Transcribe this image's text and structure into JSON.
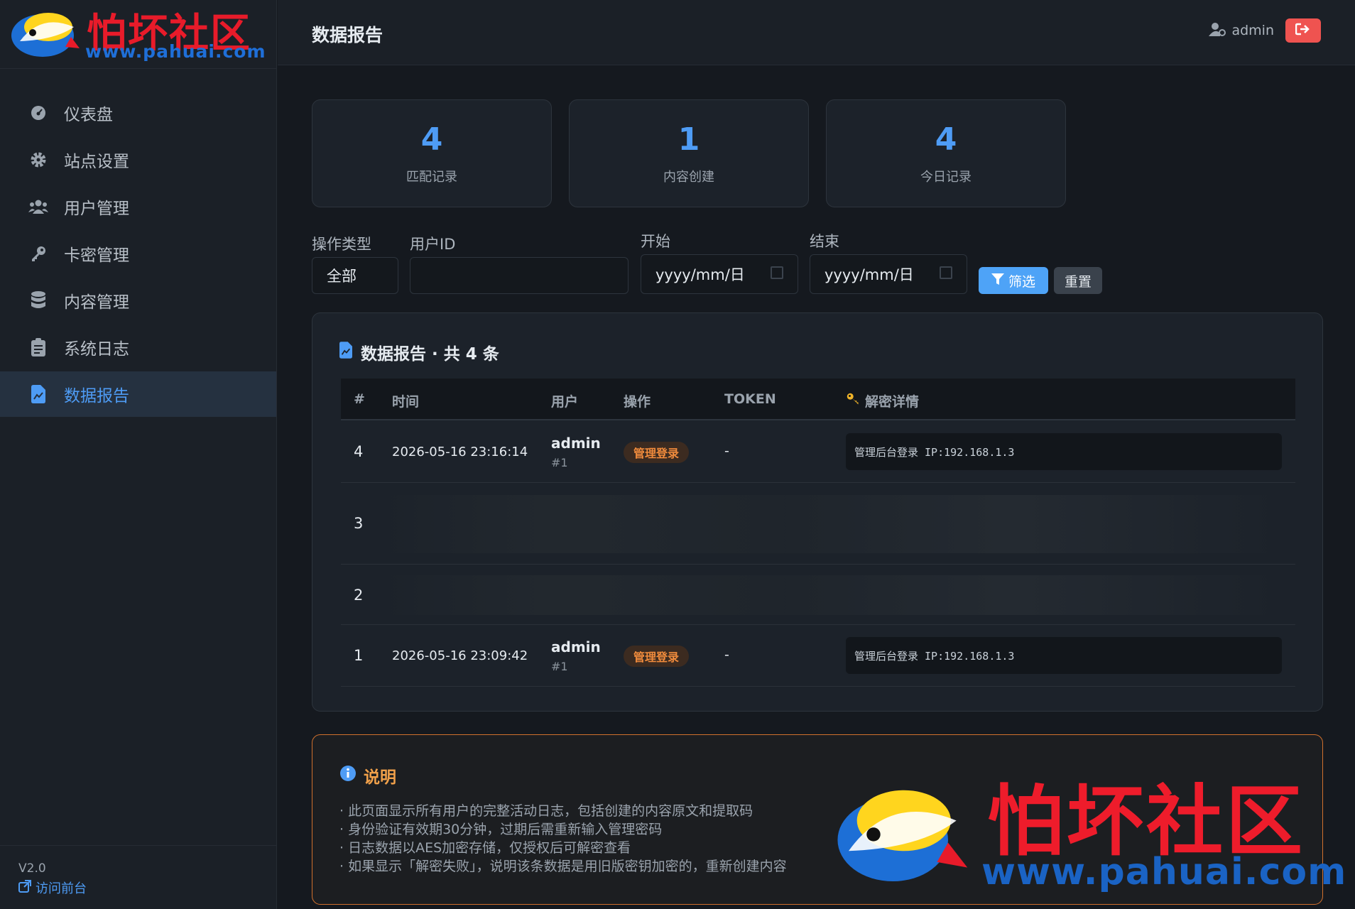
{
  "brand": {
    "logo_cn": "怕坏社区",
    "logo_url": "www.pahuai.com"
  },
  "sidebar": {
    "items": [
      {
        "label": "仪表盘",
        "icon": "dashboard-icon"
      },
      {
        "label": "站点设置",
        "icon": "gear-icon"
      },
      {
        "label": "用户管理",
        "icon": "users-icon"
      },
      {
        "label": "卡密管理",
        "icon": "key-icon"
      },
      {
        "label": "内容管理",
        "icon": "database-icon"
      },
      {
        "label": "系统日志",
        "icon": "clipboard-icon"
      },
      {
        "label": "数据报告",
        "icon": "file-chart-icon",
        "active": true
      }
    ],
    "version": "V2.0",
    "visit_label": "访问前台"
  },
  "header": {
    "title": "数据报告",
    "user": "admin"
  },
  "stats": [
    {
      "value": "4",
      "label": "匹配记录"
    },
    {
      "value": "1",
      "label": "内容创建"
    },
    {
      "value": "4",
      "label": "今日记录"
    }
  ],
  "filters": {
    "type_label": "操作类型",
    "type_value": "全部",
    "userid_label": "用户ID",
    "userid_value": "",
    "start_label": "开始",
    "start_placeholder": "yyyy/mm/日",
    "end_label": "结束",
    "end_placeholder": "yyyy/mm/日",
    "filter_button": "筛选",
    "reset_button": "重置"
  },
  "table": {
    "title": "数据报告 · 共 4 条",
    "columns": [
      "#",
      "时间",
      "用户",
      "操作",
      "TOKEN",
      "解密详情"
    ],
    "rows": [
      {
        "num": "4",
        "time": "2026-05-16 23:16:14",
        "user": "admin",
        "uid": "#1",
        "action": "管理登录",
        "token": "-",
        "detail": "管理后台登录 IP:192.168.1.3"
      },
      {
        "num": "3"
      },
      {
        "num": "2"
      },
      {
        "num": "1",
        "time": "2026-05-16 23:09:42",
        "user": "admin",
        "uid": "#1",
        "action": "管理登录",
        "token": "-",
        "detail": "管理后台登录 IP:192.168.1.3"
      }
    ]
  },
  "note": {
    "title": "说明",
    "lines": [
      "· 此页面显示所有用户的完整活动日志，包括创建的内容原文和提取码",
      "· 身份验证有效期30分钟，过期后需重新输入管理密码",
      "· 日志数据以AES加密存储，仅授权后可解密查看",
      "· 如果显示「解密失败」，说明该条数据是用旧版密钥加密的，重新创建内容"
    ]
  },
  "watermark": {
    "cn": "怕坏社区",
    "url": "www.pahuai.com"
  },
  "colors": {
    "accent": "#4e9cf5",
    "badge": "#f08b3c",
    "danger": "#ef5350",
    "note_border": "#d0702d"
  }
}
